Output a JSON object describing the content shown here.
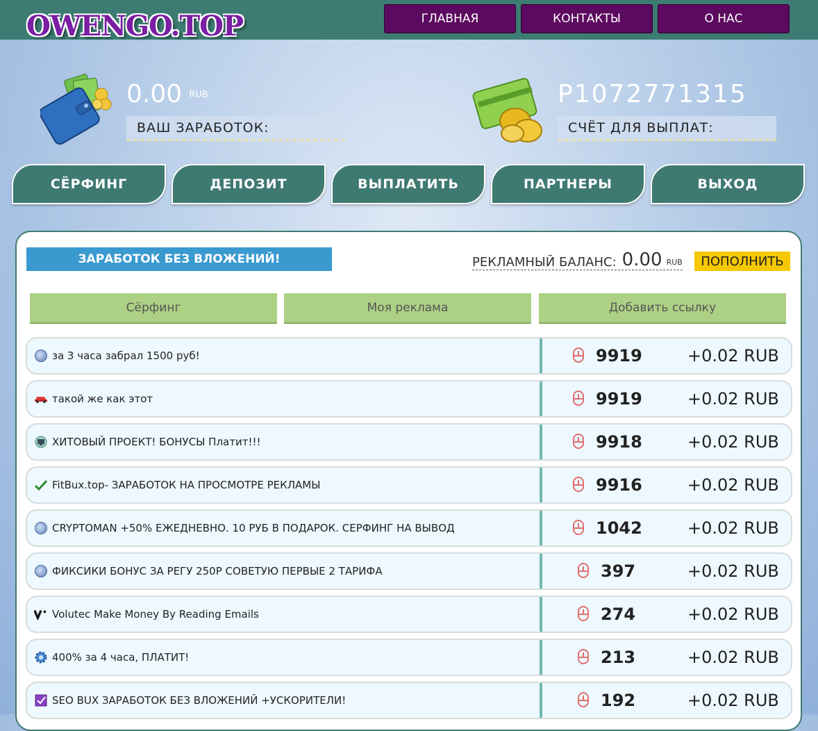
{
  "logo": "OWENGO.TOP",
  "nav": [
    "ГЛАВНАЯ",
    "КОНТАКТЫ",
    "О НАС"
  ],
  "earnings": {
    "value": "0.00",
    "unit": "RUB",
    "label": "ВАШ ЗАРАБОТОК:"
  },
  "payout": {
    "account": "P1072771315",
    "label": "СЧЁТ ДЛЯ ВЫПЛАТ:"
  },
  "menu": [
    "СЁРФИНГ",
    "ДЕПОЗИТ",
    "ВЫПЛАТИТЬ",
    "ПАРТНЕРЫ",
    "ВЫХОД"
  ],
  "promo": "ЗАРАБОТОК БЕЗ ВЛОЖЕНИЙ!",
  "ad_balance": {
    "label": "РЕКЛАМНЫЙ БАЛАНС:",
    "value": "0.00",
    "unit": "RUB",
    "topup": "ПОПОЛНИТЬ"
  },
  "tabs": [
    "Сёрфинг",
    "Моя реклама",
    "Добавить ссылку"
  ],
  "rows": [
    {
      "icon": "globe-icon",
      "title": "за 3 часа забрал 1500 руб!",
      "views": "9919",
      "price": "+0.02 RUB"
    },
    {
      "icon": "car-icon",
      "title": "такой же как этот",
      "views": "9919",
      "price": "+0.02 RUB"
    },
    {
      "icon": "monitor-icon",
      "title": "ХИТОВЫЙ ПРОЕКТ! БОНУСЫ Платит!!!",
      "views": "9918",
      "price": "+0.02 RUB"
    },
    {
      "icon": "check-icon",
      "title": "FitBux.top- ЗАРАБОТОК НА ПРОСМОТРЕ РЕКЛАМЫ",
      "views": "9916",
      "price": "+0.02 RUB"
    },
    {
      "icon": "globe-icon",
      "title": "CRYPTOMAN +50% ЕЖЕДНЕВНО. 10 РУБ В ПОДАРОК. СЕРФИНГ НА ВЫВОД",
      "views": "1042",
      "price": "+0.02 RUB"
    },
    {
      "icon": "globe-icon",
      "title": " ФИКСИКИ БОНУС ЗА РЕГУ 250Р СОВЕТУЮ ПЕРВЫЕ 2 ТАРИФА",
      "views": "397",
      "price": "+0.02 RUB"
    },
    {
      "icon": "v-logo-icon",
      "title": "Volutec Make Money By Reading Emails",
      "views": "274",
      "price": "+0.02 RUB"
    },
    {
      "icon": "gear-icon",
      "title": "400% за 4 часа, ПЛАТИТ!",
      "views": "213",
      "price": "+0.02 RUB"
    },
    {
      "icon": "purple-check-icon",
      "title": "SEO BUX ЗАРАБОТОК БЕЗ ВЛОЖЕНИЙ +УСКОРИТЕЛИ!",
      "views": "192",
      "price": "+0.02 RUB"
    }
  ]
}
